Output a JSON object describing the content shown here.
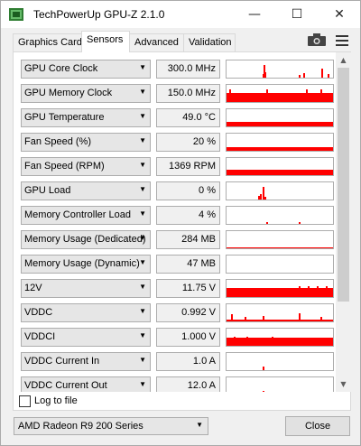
{
  "window": {
    "title": "TechPowerUp GPU-Z 2.1.0",
    "min_glyph": "—",
    "max_glyph": "☐",
    "close_glyph": "✕"
  },
  "tabs": [
    {
      "label": "Graphics Card",
      "active": false
    },
    {
      "label": "Sensors",
      "active": true
    },
    {
      "label": "Advanced",
      "active": false
    },
    {
      "label": "Validation",
      "active": false
    }
  ],
  "graph_color": "#ff0000",
  "sensors": [
    {
      "name": "GPU Core Clock",
      "value": "300.0 MHz"
    },
    {
      "name": "GPU Memory Clock",
      "value": "150.0 MHz"
    },
    {
      "name": "GPU Temperature",
      "value": "49.0 °C"
    },
    {
      "name": "Fan Speed (%)",
      "value": "20 %"
    },
    {
      "name": "Fan Speed (RPM)",
      "value": "1369 RPM"
    },
    {
      "name": "GPU Load",
      "value": "0 %"
    },
    {
      "name": "Memory Controller Load",
      "value": "4 %"
    },
    {
      "name": "Memory Usage (Dedicated)",
      "value": "284 MB"
    },
    {
      "name": "Memory Usage (Dynamic)",
      "value": "47 MB"
    },
    {
      "name": "12V",
      "value": "11.75 V"
    },
    {
      "name": "VDDC",
      "value": "0.992 V"
    },
    {
      "name": "VDDCI",
      "value": "1.000 V"
    },
    {
      "name": "VDDC Current In",
      "value": "1.0 A"
    },
    {
      "name": "VDDC Current Out",
      "value": "12.0 A"
    }
  ],
  "log_to_file": {
    "label": "Log to file",
    "checked": false
  },
  "gpu_select": {
    "value": "AMD Radeon R9 200 Series"
  },
  "close_label": "Close"
}
